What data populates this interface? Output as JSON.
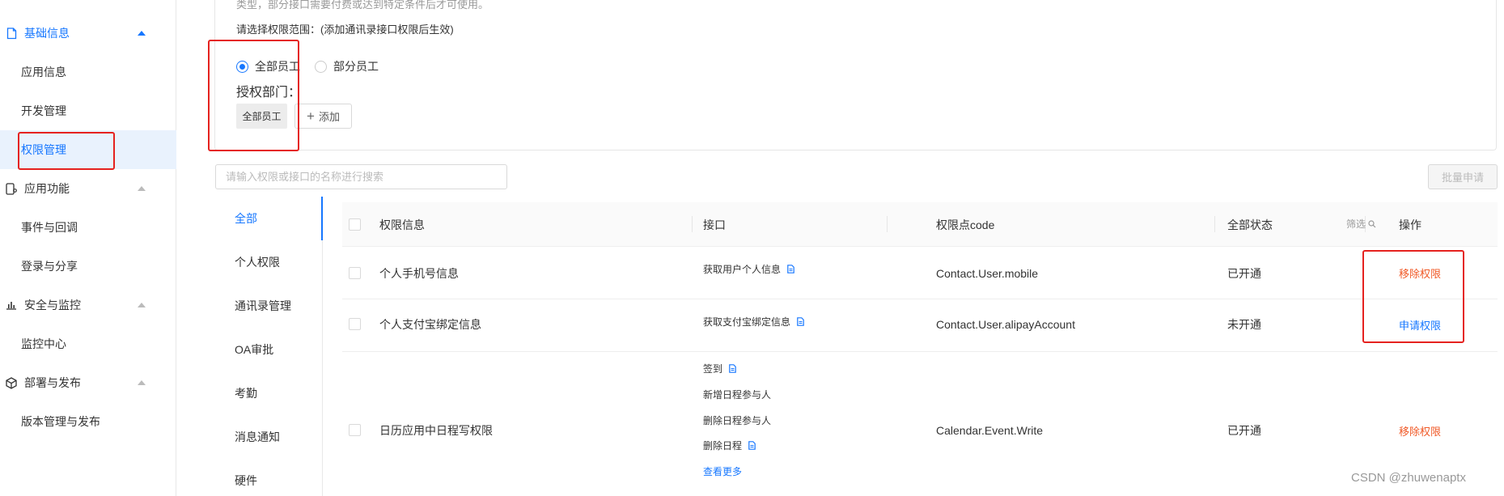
{
  "sidebar": {
    "groups": [
      {
        "label": "基础信息",
        "icon": "document-icon",
        "expanded": true
      },
      {
        "label": "应用功能",
        "icon": "app-phone-icon",
        "expanded": true
      },
      {
        "label": "安全与监控",
        "icon": "bar-chart-icon",
        "expanded": true
      },
      {
        "label": "部署与发布",
        "icon": "cube-icon",
        "expanded": true
      }
    ],
    "items": [
      {
        "label": "应用信息"
      },
      {
        "label": "开发管理"
      },
      {
        "label": "权限管理",
        "selected": true
      },
      {
        "label": "事件与回调"
      },
      {
        "label": "登录与分享"
      },
      {
        "label": "监控中心"
      },
      {
        "label": "版本管理与发布"
      }
    ]
  },
  "scope": {
    "top_hint": "类型，部分接口需要付费或达到特定条件后才可使用。",
    "label": "请选择权限范围：(添加通讯录接口权限后生效)",
    "options": [
      {
        "label": "全部员工",
        "checked": true
      },
      {
        "label": "部分员工",
        "checked": false
      }
    ],
    "dept_label": "授权部门：",
    "dept_tag": "全部员工",
    "add_label": "添加"
  },
  "search": {
    "placeholder": "请输入权限或接口的名称进行搜索"
  },
  "batch_button": "批量申请",
  "categories": [
    {
      "label": "全部",
      "active": true
    },
    {
      "label": "个人权限"
    },
    {
      "label": "通讯录管理"
    },
    {
      "label": "OA审批"
    },
    {
      "label": "考勤"
    },
    {
      "label": "消息通知"
    },
    {
      "label": "硬件"
    }
  ],
  "table": {
    "headers": {
      "info": "权限信息",
      "api": "接口",
      "code": "权限点code",
      "status": "全部状态",
      "filter": "筛选",
      "action": "操作"
    },
    "rows": [
      {
        "name": "个人手机号信息",
        "apis": [
          "获取用户个人信息"
        ],
        "code": "Contact.User.mobile",
        "status": "已开通",
        "action": "移除权限"
      },
      {
        "name": "个人支付宝绑定信息",
        "apis": [
          "获取支付宝绑定信息"
        ],
        "code": "Contact.User.alipayAccount",
        "status": "未开通",
        "action": "申请权限"
      },
      {
        "name": "日历应用中日程写权限",
        "apis": [
          "签到",
          "新增日程参与人",
          "删除日程参与人",
          "删除日程"
        ],
        "more": "查看更多",
        "code": "Calendar.Event.Write",
        "status": "已开通",
        "action": "移除权限"
      }
    ]
  },
  "colors": {
    "accent": "#1677ff",
    "danger": "#f05a28",
    "highlight_box": "#e5221f"
  },
  "watermark": "CSDN @zhuwenaptx"
}
